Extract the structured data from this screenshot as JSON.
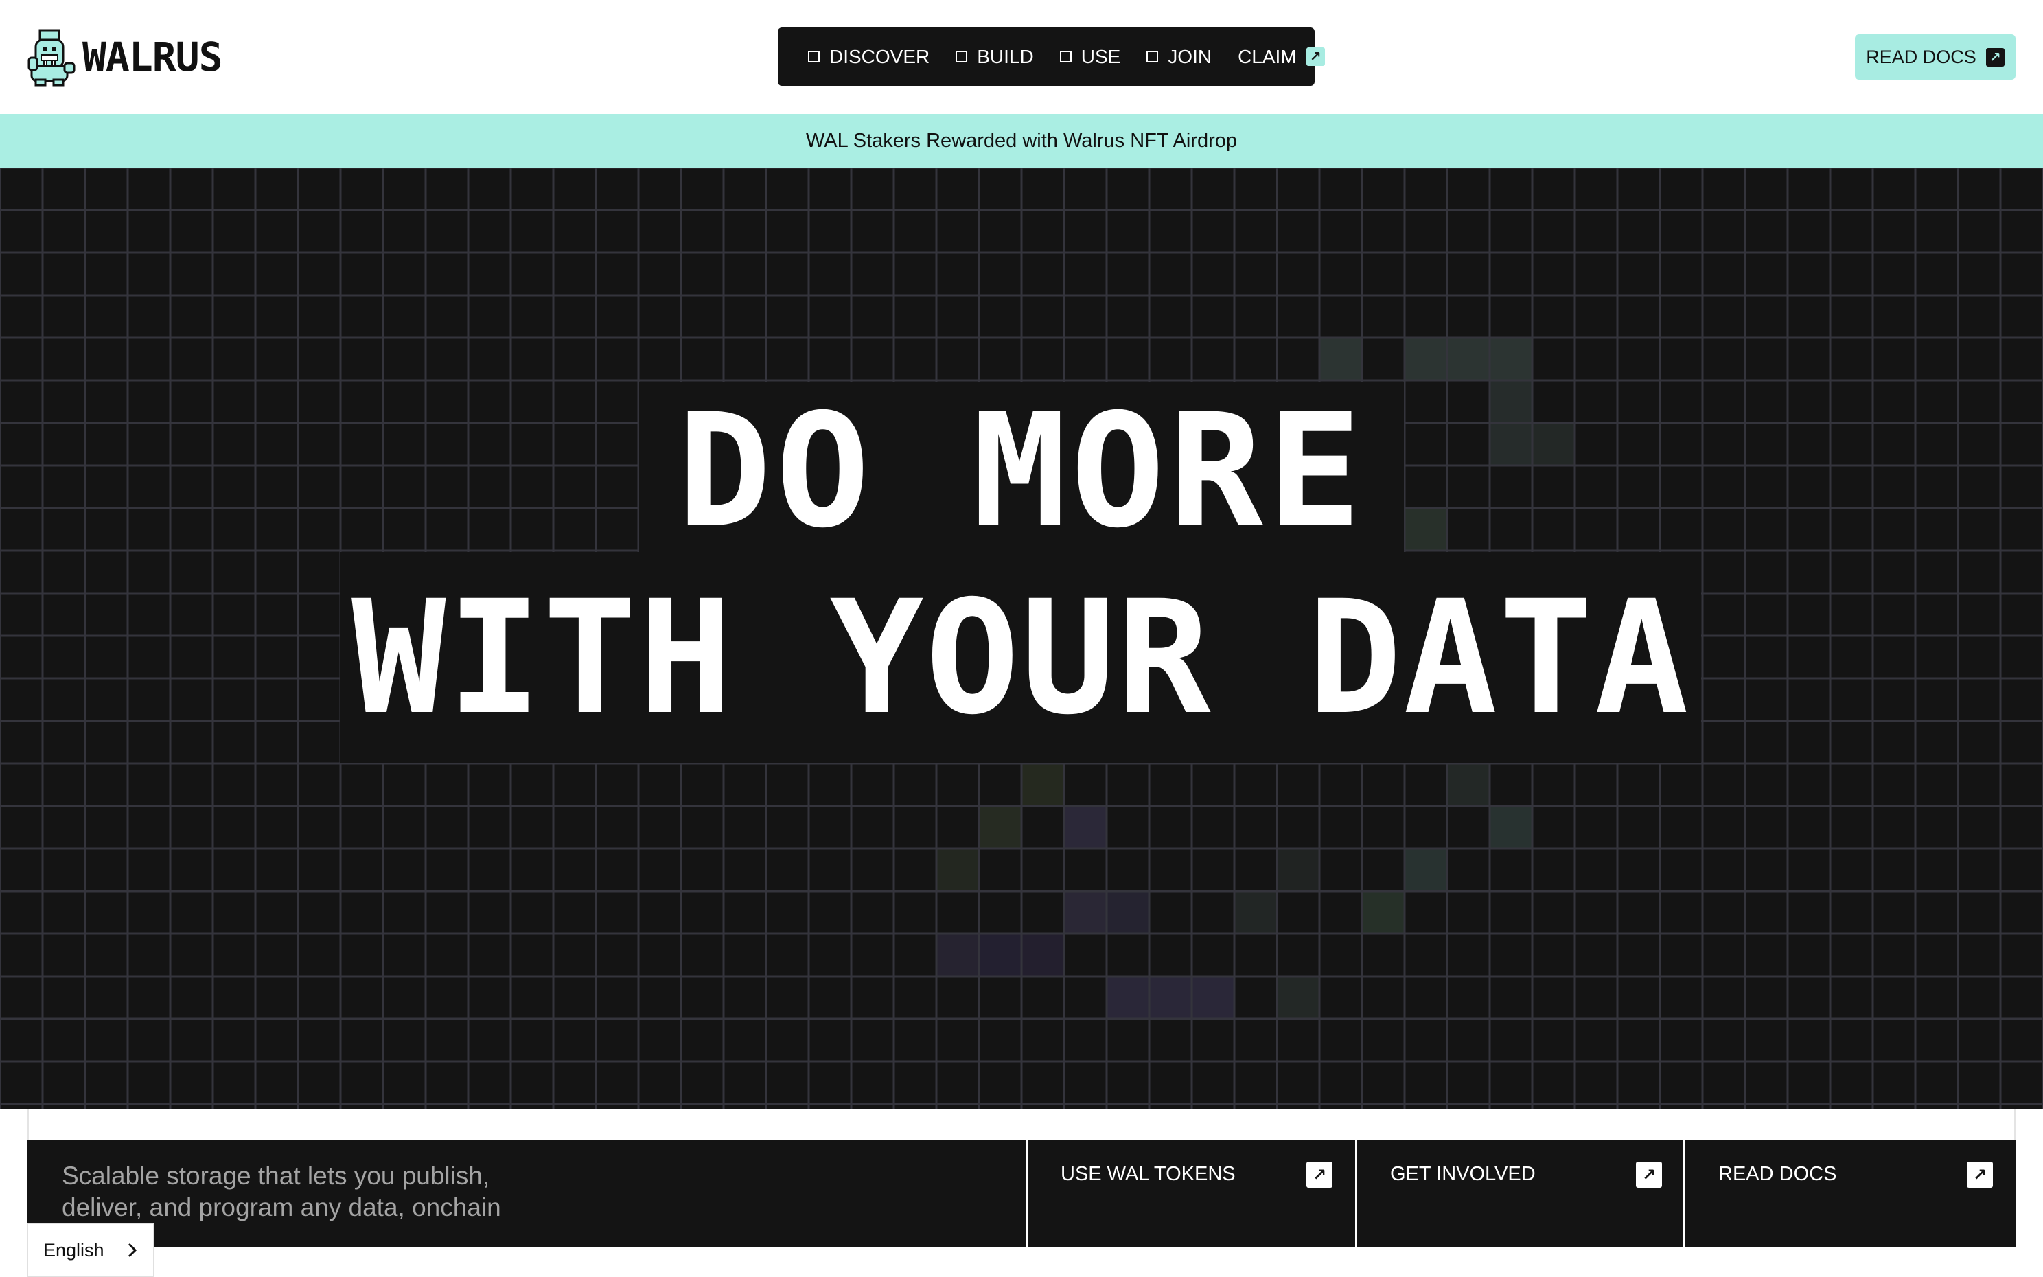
{
  "brand": {
    "name": "WALRUS",
    "accent": "#a8ece2",
    "dark": "#141414"
  },
  "nav": {
    "items": [
      {
        "label": "DISCOVER"
      },
      {
        "label": "BUILD"
      },
      {
        "label": "USE"
      },
      {
        "label": "JOIN"
      }
    ],
    "claim": {
      "label": "CLAIM",
      "icon": "arrow-up-right-icon"
    }
  },
  "header": {
    "docs_label": "READ DOCS",
    "docs_icon": "arrow-up-right-icon"
  },
  "banner": {
    "text": "WAL Stakers Rewarded with Walrus NFT Airdrop"
  },
  "hero": {
    "line1": "DO MORE",
    "line2": "WITH YOUR DATA"
  },
  "bottom": {
    "tagline_1": "Scalable storage that lets you publish,",
    "tagline_2": "deliver, and program any data, onchain",
    "ctas": [
      {
        "label": "USE WAL TOKENS",
        "icon": "arrow-up-right-icon"
      },
      {
        "label": "GET INVOLVED",
        "icon": "arrow-up-right-icon"
      },
      {
        "label": "READ DOCS",
        "icon": "arrow-up-right-icon"
      }
    ]
  },
  "language": {
    "selected": "English",
    "icon": "chevron-right-icon"
  }
}
